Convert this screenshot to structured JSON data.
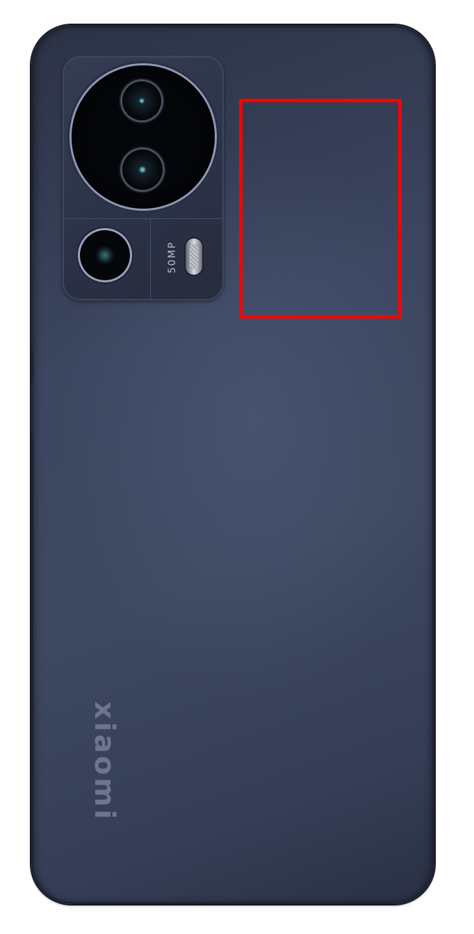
{
  "image": {
    "subject": "smartphone-back",
    "colors": {
      "body": "#3e4861",
      "camera_module": "#2c3246",
      "lens_ring": "#8e98b8",
      "highlight": "#ff0000",
      "brand_text": "#6d7590"
    }
  },
  "camera": {
    "spec_label": "50MP"
  },
  "branding": {
    "logo_text": "xiaomi"
  }
}
